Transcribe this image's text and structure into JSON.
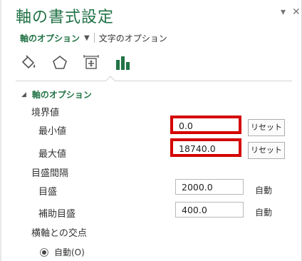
{
  "pane": {
    "title": "軸の書式設定",
    "dropdown_icon": "▾",
    "close_icon": "✕"
  },
  "tabs": {
    "active": "軸のオプション",
    "arrow": "▼",
    "inactive": "文字のオプション"
  },
  "category_icons": [
    "fill-line-icon",
    "effects-icon",
    "size-properties-icon",
    "axis-options-icon"
  ],
  "section": {
    "toggle": "◢",
    "title": "軸のオプション"
  },
  "bounds": {
    "heading": "境界値",
    "min_label": "最小値",
    "min_value": "0.0",
    "max_label": "最大値",
    "max_value": "18740.0",
    "reset_label": "リセット"
  },
  "units": {
    "heading": "目盛間隔",
    "major_label": "目盛",
    "major_value": "2000.0",
    "minor_label": "補助目盛",
    "minor_value": "400.0",
    "auto_label": "自動"
  },
  "cross": {
    "heading": "横軸との交点",
    "auto_option": "自動(O)"
  },
  "colors": {
    "accent": "#217346",
    "highlight": "#d40000"
  }
}
